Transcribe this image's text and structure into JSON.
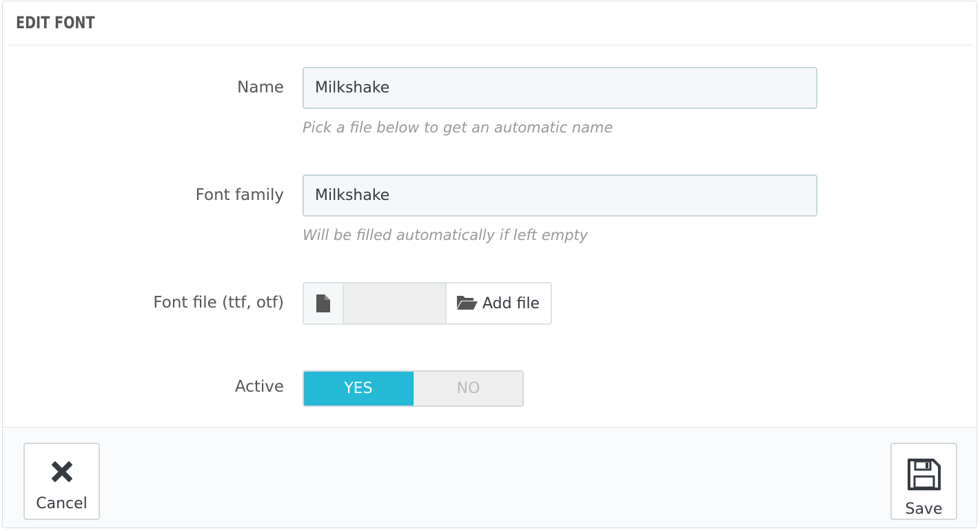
{
  "panel": {
    "title": "EDIT FONT"
  },
  "form": {
    "name": {
      "label": "Name",
      "value": "Milkshake",
      "help": "Pick a file below to get an automatic name"
    },
    "font_family": {
      "label": "Font family",
      "value": "Milkshake",
      "help": "Will be filled automatically if left empty"
    },
    "font_file": {
      "label": "Font file (ttf, otf)",
      "add_label": "Add file",
      "file_icon": "file-icon",
      "folder_icon": "folder-open-icon"
    },
    "active": {
      "label": "Active",
      "yes": "YES",
      "no": "NO",
      "selected": "YES"
    }
  },
  "footer": {
    "cancel_label": "Cancel",
    "save_label": "Save",
    "cancel_icon": "close-icon",
    "save_icon": "save-icon"
  },
  "colors": {
    "accent": "#25b9d7",
    "text": "#363a41",
    "help_text": "#999999"
  }
}
